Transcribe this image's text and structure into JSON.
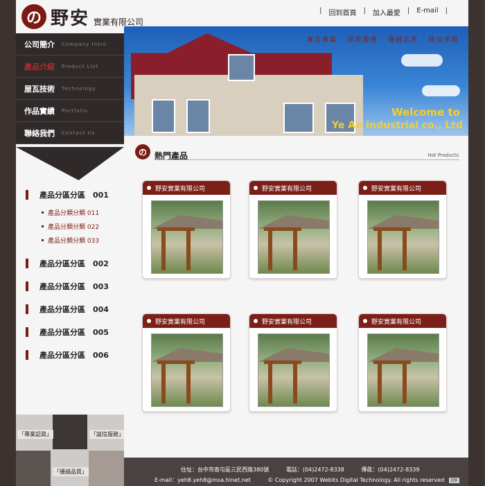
{
  "header": {
    "logo_mark": "の",
    "logo_cn": "野安",
    "company": "實業有限公司",
    "links": [
      "回到首頁",
      "加入最愛",
      "E-mail"
    ],
    "slogan": "專注專業 · 認眞服務 · 優越品質 · 精益求精"
  },
  "banner": {
    "welcome": "Welcome to",
    "company_en": "Ye An Industrial co., Ltd"
  },
  "nav": [
    {
      "cn": "公司簡介",
      "en": "Company Intro",
      "active": false
    },
    {
      "cn": "產品介紹",
      "en": "Product List",
      "active": true
    },
    {
      "cn": "屋瓦技術",
      "en": "Technology",
      "active": false
    },
    {
      "cn": "作品實績",
      "en": "Portfolio",
      "active": false
    },
    {
      "cn": "聯絡我們",
      "en": "Contact Us",
      "active": false
    }
  ],
  "categories": {
    "cat1": "產品分區分區　001",
    "subs": [
      "產品分類分類 011",
      "產品分類分類 022",
      "產品分類分類 033"
    ],
    "others": [
      "產品分區分區　002",
      "產品分區分區　003",
      "產品分區分區　004",
      "產品分區分區　005",
      "產品分區分區　006"
    ]
  },
  "side_thumbs": [
    "「專業認眞」",
    "「誠信服務」",
    "「優越品質」"
  ],
  "hot": {
    "icon": "の",
    "title": "熱門產品",
    "en": "Hot Products"
  },
  "products": [
    "野安實業有限公司",
    "野安實業有限公司",
    "野安實業有限公司",
    "野安實業有限公司",
    "野安實業有限公司",
    "野安實業有限公司"
  ],
  "footer": {
    "address": "住址：台中市南屯區三民西路380號",
    "phone": "電話：(04)2472-8338",
    "fax": "傳眞：(04)2472-8339",
    "email": "E-mail：yeh8.yeh8@msa.hinet.net",
    "copyright": "© Copyright 2007 Webits Digital Technology. All rights reserved",
    "badge": "09"
  }
}
